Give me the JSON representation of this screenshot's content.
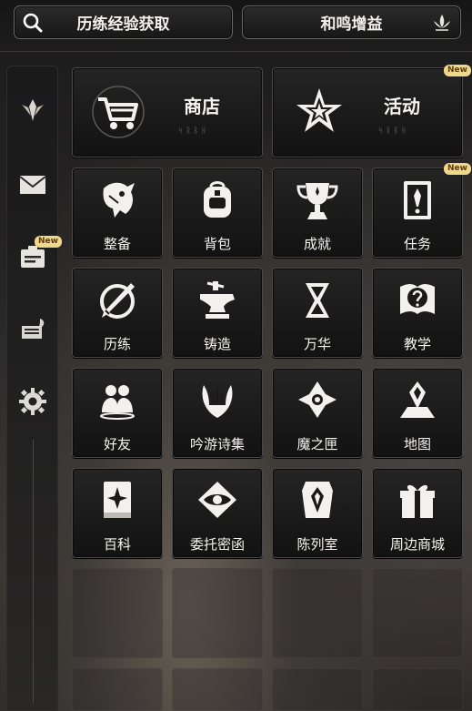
{
  "topbar": {
    "left_label": "历练经验获取",
    "right_label": "和鸣增益"
  },
  "badge_text": "New",
  "sidebar": {
    "items": [
      {
        "icon": "crest-icon"
      },
      {
        "icon": "mail-icon"
      },
      {
        "icon": "id-card-icon",
        "badge": "New"
      },
      {
        "icon": "book-feather-icon"
      },
      {
        "icon": "gear-icon"
      }
    ]
  },
  "big_tiles": [
    {
      "label": "商店",
      "runes": "ᛋᚱᛒᚺ",
      "icon": "cart-icon"
    },
    {
      "label": "活动",
      "runes": "ᛋᚱᛒᚺ",
      "icon": "star-icon",
      "badge": "New"
    }
  ],
  "tiles": [
    {
      "label": "整备",
      "icon": "dragon-icon"
    },
    {
      "label": "背包",
      "icon": "backpack-icon"
    },
    {
      "label": "成就",
      "icon": "trophy-icon"
    },
    {
      "label": "任务",
      "icon": "quest-scroll-icon",
      "badge": "New"
    },
    {
      "label": "历练",
      "icon": "sword-ring-icon"
    },
    {
      "label": "铸造",
      "icon": "anvil-icon"
    },
    {
      "label": "万华",
      "icon": "knot-icon"
    },
    {
      "label": "教学",
      "icon": "help-book-icon"
    },
    {
      "label": "好友",
      "icon": "friends-icon"
    },
    {
      "label": "吟游诗集",
      "icon": "lyre-icon"
    },
    {
      "label": "魔之匣",
      "icon": "magic-box-icon"
    },
    {
      "label": "地图",
      "icon": "map-icon"
    },
    {
      "label": "百科",
      "icon": "encyclopedia-icon"
    },
    {
      "label": "委托密函",
      "icon": "eye-letter-icon"
    },
    {
      "label": "陈列室",
      "icon": "gallery-icon"
    },
    {
      "label": "周边商城",
      "icon": "gift-box-icon"
    }
  ],
  "colors": {
    "badge": "#f0d88a",
    "tile_border": "#4a4848",
    "text": "#f4f3f0"
  }
}
